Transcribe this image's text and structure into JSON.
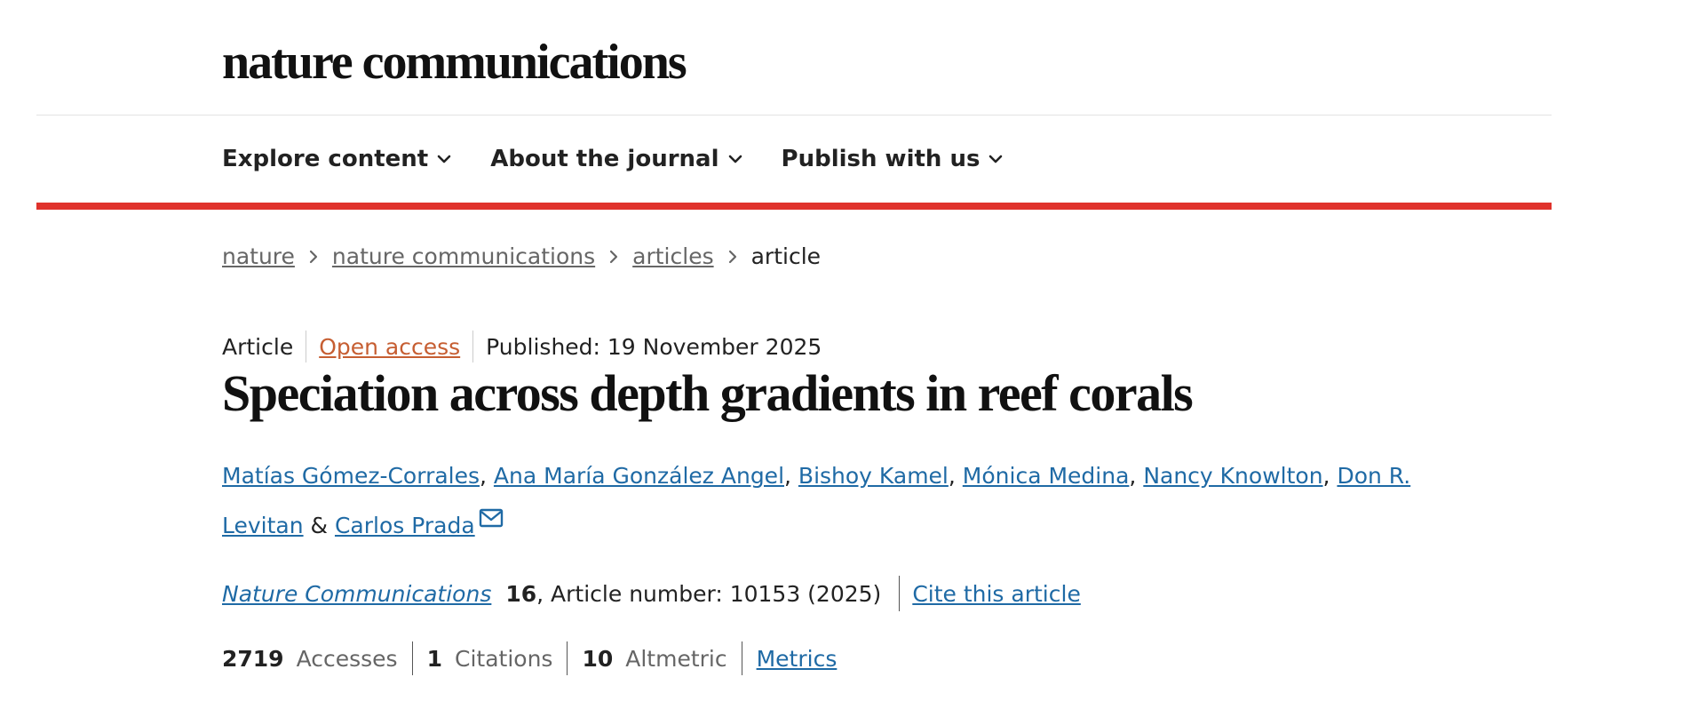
{
  "header": {
    "logo": "nature communications"
  },
  "nav": {
    "items": [
      {
        "label": "Explore content"
      },
      {
        "label": "About the journal"
      },
      {
        "label": "Publish with us"
      }
    ]
  },
  "breadcrumb": {
    "items": [
      {
        "label": "nature"
      },
      {
        "label": "nature communications"
      },
      {
        "label": "articles"
      }
    ],
    "current": "article"
  },
  "article": {
    "type": "Article",
    "access": "Open access",
    "published": "Published: 19 November 2025",
    "title": "Speciation across depth gradients in reef corals",
    "authors": [
      "Matías Gómez-Corrales",
      "Ana María González Angel",
      "Bishoy Kamel",
      "Mónica Medina",
      "Nancy Knowlton",
      "Don R. Levitan",
      "Carlos Prada"
    ],
    "author_separator": ", ",
    "author_final_separator": " & ",
    "corresponding_icon": "envelope-icon",
    "citation": {
      "journal": "Nature Communications",
      "volume": "16",
      "details": ", Article number: 10153 (2025)",
      "cite_link": "Cite this article"
    },
    "metrics": {
      "accesses_value": "2719",
      "accesses_label": "Accesses",
      "citations_value": "1",
      "citations_label": "Citations",
      "altmetric_value": "10",
      "altmetric_label": "Altmetric",
      "metrics_link": "Metrics"
    }
  },
  "colors": {
    "accent_red": "#e0322c",
    "link_blue": "#1f6aa5",
    "open_access_orange": "#c65e32"
  }
}
